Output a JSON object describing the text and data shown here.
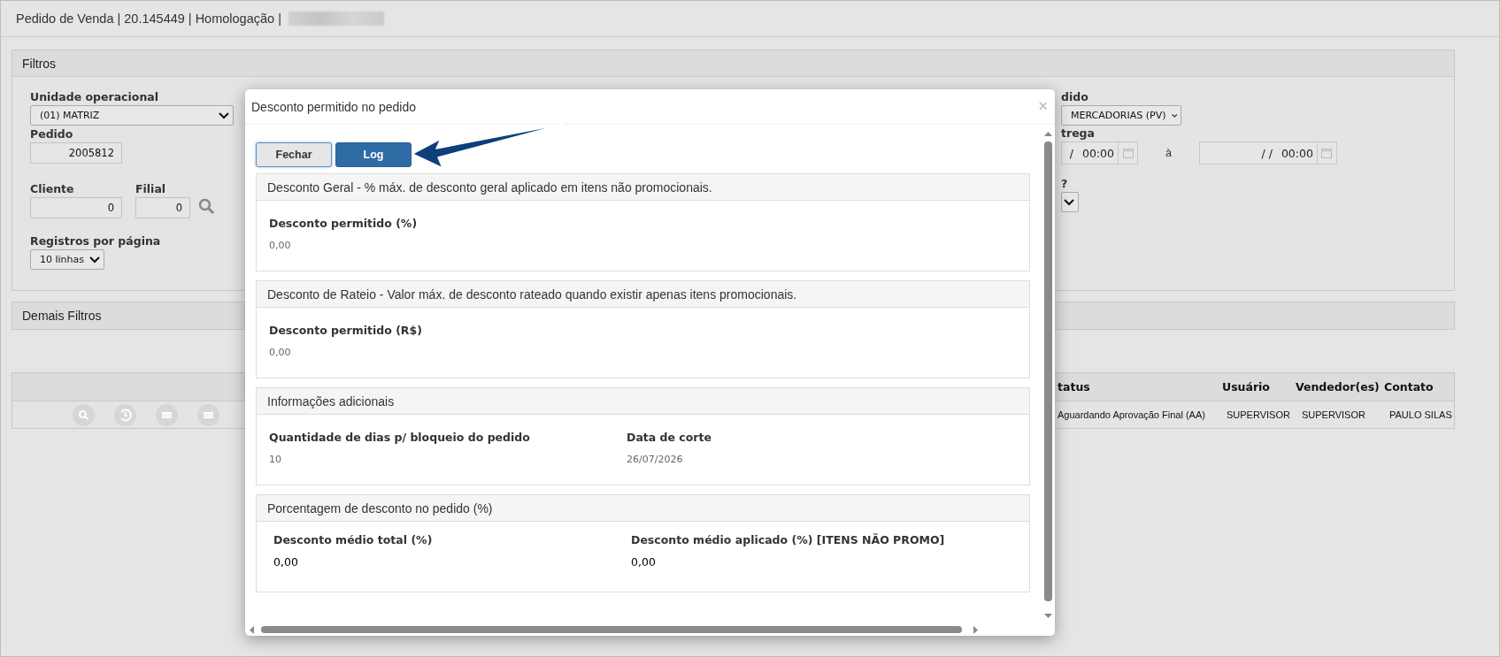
{
  "header": {
    "title": "Pedido de Venda | 20.145449 | Homologação |"
  },
  "filters": {
    "title": "Filtros",
    "unit": {
      "label": "Unidade operacional",
      "value": "(01) MATRIZ"
    },
    "order": {
      "label": "Pedido",
      "value": "2005812"
    },
    "client": {
      "label": "Cliente",
      "value": "0"
    },
    "branch": {
      "label": "Filial",
      "value": "0"
    },
    "page_size": {
      "label": "Registros por página",
      "value": "10 linhas"
    },
    "order_type": {
      "label": "dido",
      "value": "MERCADORIAS (PV)"
    },
    "delivery": {
      "label": "trega",
      "date_from": "/",
      "time_from": "00:00",
      "separator": "à",
      "date_to": "/ /",
      "time_to": "00:00"
    },
    "question": {
      "label": "?"
    }
  },
  "other_filters": {
    "title": "Demais Filtros"
  },
  "table": {
    "columns": [
      "tatus",
      "Usuário",
      "Vendedor(es)",
      "Contato"
    ],
    "rows": [
      {
        "cells": [
          "Aguardando Aprovação Final (AA)",
          "SUPERVISOR",
          "SUPERVISOR",
          "PAULO SILAS"
        ]
      }
    ]
  },
  "modal": {
    "title": "Desconto permitido no pedido",
    "close": "×",
    "buttons": [
      {
        "label": "Fechar",
        "kind": "default"
      },
      {
        "label": "Log",
        "kind": "primary"
      }
    ],
    "sections": [
      {
        "title": "Desconto Geral - % máx. de desconto geral aplicado em itens não promocionais.",
        "kind": "muted",
        "fields": [
          {
            "label": "Desconto permitido (%)",
            "value": "0,00"
          }
        ]
      },
      {
        "title": "Desconto de Rateio - Valor máx. de desconto rateado quando existir apenas itens promocionais.",
        "kind": "muted",
        "fields": [
          {
            "label": "Desconto permitido (R$)",
            "value": "0,00"
          }
        ]
      },
      {
        "title": "Informações adicionais",
        "kind": "muted",
        "fields": [
          {
            "label": "Quantidade de dias p/ bloqueio do pedido",
            "value": "10"
          },
          {
            "label": "Data de corte",
            "value": "26/07/2026"
          }
        ]
      },
      {
        "title": "Porcentagem de desconto no pedido (%)",
        "kind": "strong",
        "fields": [
          {
            "label": "Desconto médio total (%)",
            "value": "0,00"
          },
          {
            "label": "Desconto médio aplicado (%) [ITENS NÃO PROMO]",
            "value": "0,00"
          }
        ]
      }
    ]
  }
}
